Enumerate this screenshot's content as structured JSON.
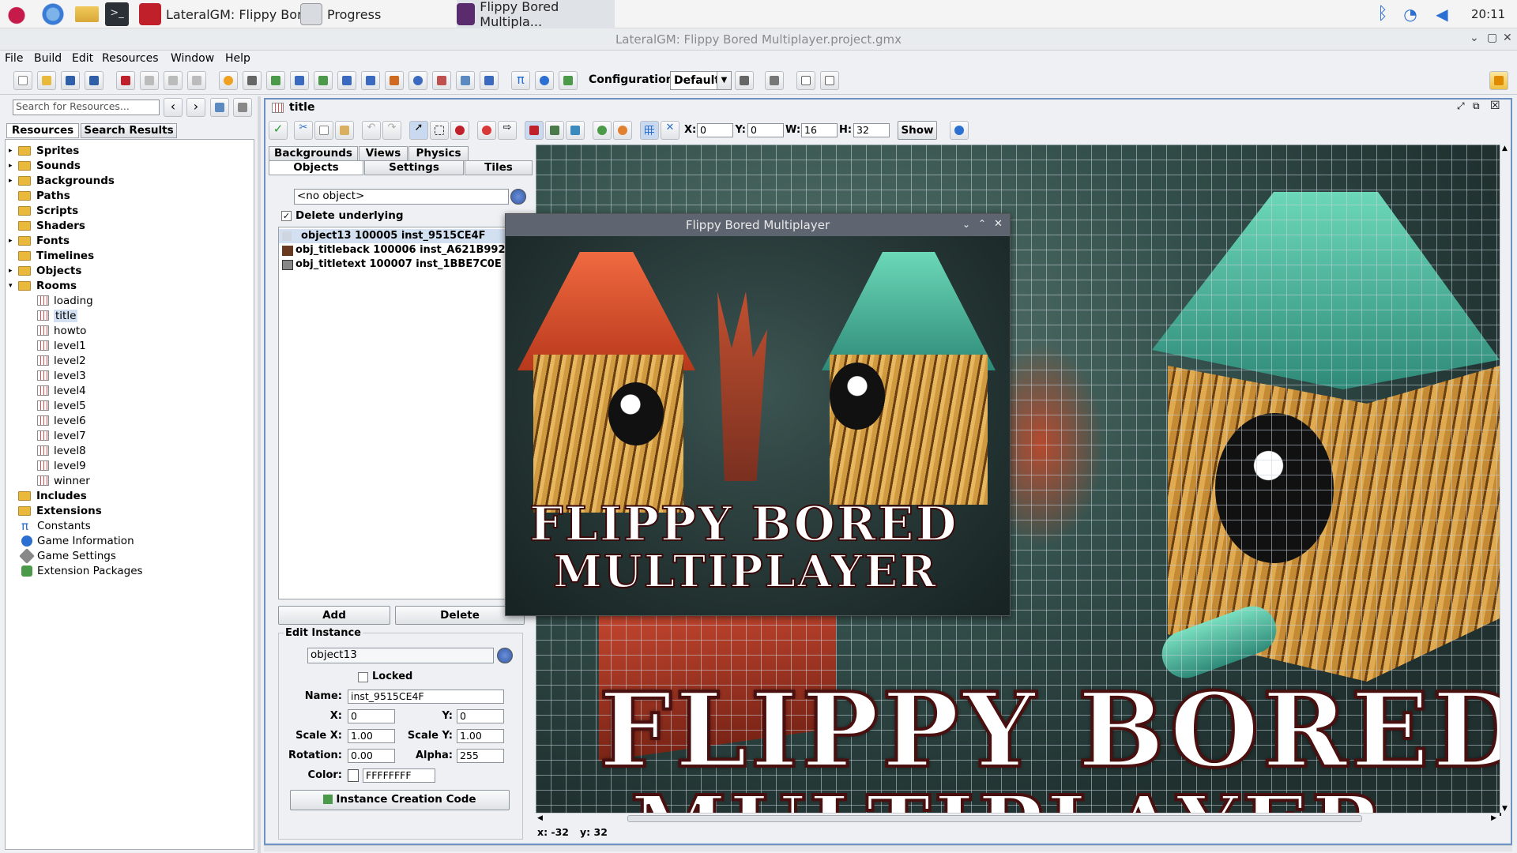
{
  "taskbar": {
    "items": [
      {
        "label": "LateralGM: Flippy Bor..."
      },
      {
        "label": "Progress"
      },
      {
        "label": "Flippy Bored Multipla..."
      }
    ],
    "clock": "20:11"
  },
  "window": {
    "title": "LateralGM: Flippy Bored Multiplayer.project.gmx"
  },
  "menu": [
    "File",
    "Build",
    "Edit",
    "Resources",
    "Window",
    "Help"
  ],
  "toolbar": {
    "configuration_label": "Configuration:",
    "configuration_value": "Default"
  },
  "left": {
    "search_placeholder": "Search for Resources...",
    "tabs": [
      "Resources",
      "Search Results"
    ],
    "tree": {
      "folders": [
        "Sprites",
        "Sounds",
        "Backgrounds",
        "Paths",
        "Scripts",
        "Shaders",
        "Fonts",
        "Timelines",
        "Objects",
        "Rooms"
      ],
      "rooms": [
        "loading",
        "title",
        "howto",
        "level1",
        "level2",
        "level3",
        "level4",
        "level5",
        "level6",
        "level7",
        "level8",
        "level9",
        "winner"
      ],
      "after": [
        "Includes",
        "Extensions"
      ],
      "items": [
        "Constants",
        "Game Information",
        "Game Settings",
        "Extension Packages"
      ]
    }
  },
  "room": {
    "title": "title",
    "toolbar": {
      "x_label": "X:",
      "x": "0",
      "y_label": "Y:",
      "y": "0",
      "w_label": "W:",
      "w": "16",
      "h_label": "H:",
      "h": "32",
      "show": "Show"
    },
    "tabs_row1": [
      "Backgrounds",
      "Views",
      "Physics"
    ],
    "tabs_row2": [
      "Objects",
      "Settings",
      "Tiles"
    ],
    "object_select": "<no object>",
    "delete_underlying": "Delete underlying",
    "instances": [
      "object13 100005 inst_9515CE4F",
      "obj_titleback 100006 inst_A621B992",
      "obj_titletext 100007 inst_1BBE7C0E"
    ],
    "add": "Add",
    "delete": "Delete",
    "edit": {
      "heading": "Edit Instance",
      "object": "object13",
      "locked": "Locked",
      "name_label": "Name:",
      "name": "inst_9515CE4F",
      "x_label": "X:",
      "x": "0",
      "y_label": "Y:",
      "y": "0",
      "sx_label": "Scale X:",
      "sx": "1.00",
      "sy_label": "Scale Y:",
      "sy": "1.00",
      "rot_label": "Rotation:",
      "rot": "0.00",
      "alpha_label": "Alpha:",
      "alpha": "255",
      "color_label": "Color:",
      "color": "FFFFFFFF",
      "creation_code": "Instance Creation Code"
    },
    "status": {
      "x": "x: -32",
      "y": "y: 32"
    }
  },
  "game": {
    "title": "Flippy Bored Multiplayer",
    "logo_line1": "FLIPPY BORED",
    "logo_line2": "MULTIPLAYER"
  },
  "canvas_text": {
    "line1": "FLIPPY BORED",
    "line2": "MULTIPLAYER"
  },
  "colors": {
    "accent": "#1a73e8",
    "red_box": "#d8502e",
    "teal_box": "#47b7a0",
    "wood": "#b07a2e"
  }
}
